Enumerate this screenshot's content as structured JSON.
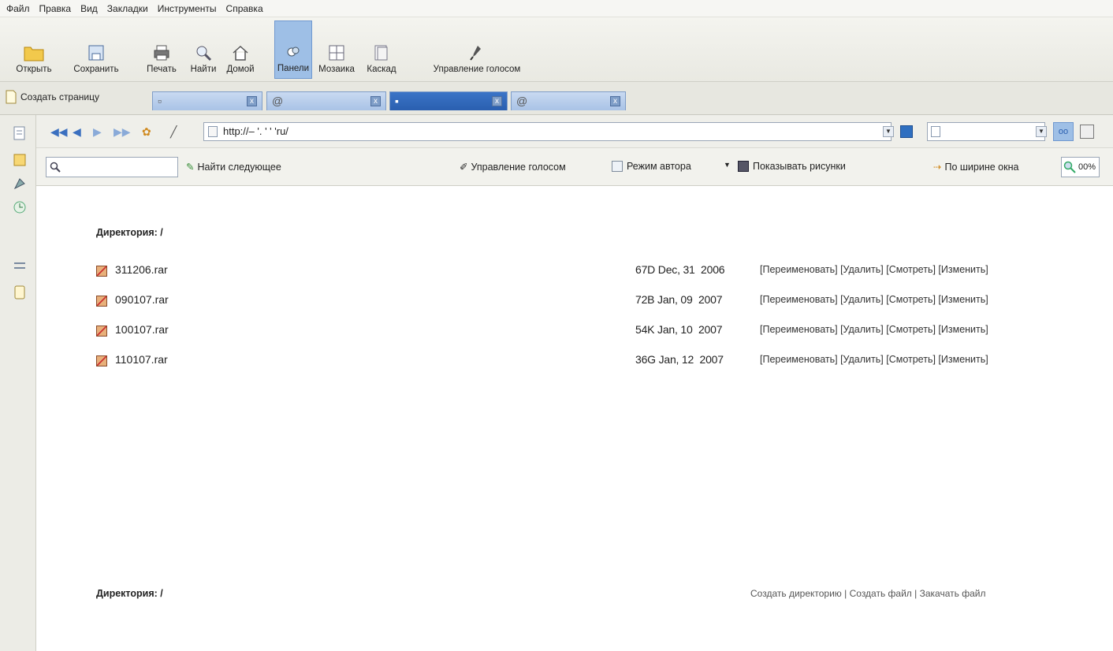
{
  "menu": [
    "Файл",
    "Правка",
    "Вид",
    "Закладки",
    "Инструменты",
    "Справка"
  ],
  "toolbar": {
    "open": "Открыть",
    "save": "Сохранить",
    "print": "Печать",
    "find": "Найти",
    "home": "Домой",
    "panels": "Панели",
    "mosaic": "Мозаика",
    "cascade": "Каскад",
    "voice": "Управление голосом"
  },
  "tabs": {
    "new_page": "Создать страницу",
    "tab2_icon": "@",
    "tab4_icon": "@",
    "close": "x"
  },
  "address": {
    "url": "http://‒  '.    '    '   'ru/"
  },
  "findbar": {
    "find_next": "Найти следующее",
    "voice": "Управление голосом",
    "author_mode": "Режим автора",
    "show_images": "Показывать рисунки",
    "fit_width": "По ширине окна",
    "zoom": "00%"
  },
  "listing": {
    "dir_label": "Директория: /",
    "files": [
      {
        "name": "311206.rar",
        "size": "67D",
        "date": "Dec, 31",
        "year": "2006"
      },
      {
        "name": "090107.rar",
        "size": "72B",
        "date": "Jan, 09",
        "year": "2007"
      },
      {
        "name": "100107.rar",
        "size": "54K",
        "date": "Jan, 10",
        "year": "2007"
      },
      {
        "name": "110107.rar",
        "size": "36G",
        "date": "Jan, 12",
        "year": "2007"
      }
    ],
    "actions": {
      "rename": "[Переименовать]",
      "delete": "[Удалить]",
      "view": "[Смотреть]",
      "edit": "[Изменить]"
    },
    "footer": {
      "dir_label": "Директория: /",
      "create_dir": "Создать директорию",
      "create_file": "Создать файл",
      "upload": "Закачать файл",
      "sep": "|"
    }
  },
  "colors": {
    "active_button": "#9ebfe6",
    "selected_tab": "#2a5fb0",
    "tab": "#b8cfec"
  }
}
